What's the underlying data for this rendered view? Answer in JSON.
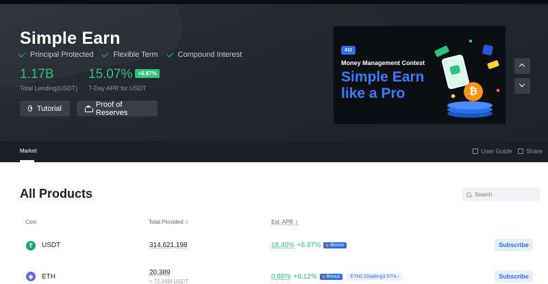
{
  "hero": {
    "title": "Simple Earn",
    "features": [
      "Principal Protected",
      "Flexible Term",
      "Compound Interest"
    ],
    "stats": [
      {
        "value": "1.17B",
        "label": "Total Lending(USDT)"
      },
      {
        "value": "15.07%",
        "badge": "+8.87%",
        "label": "7-Day APR for USDT"
      }
    ],
    "buttons": {
      "tutorial": "Tutorial",
      "reserves": "Proof of Reserves"
    },
    "banner": {
      "number": "#11",
      "subtitle": "Money Management Contest",
      "headline_1": "Simple Earn",
      "headline_2": "like a Pro"
    }
  },
  "tabs": {
    "market": "Market",
    "user_guide": "User Guide",
    "share": "Share"
  },
  "products": {
    "title": "All Products",
    "search_placeholder": "Search",
    "headers": {
      "coin": "Coin",
      "provided": "Total Provided",
      "apr": "Est. APR"
    },
    "sort_glyph": "⇕",
    "rows": [
      {
        "coin": "USDT",
        "icon": "T",
        "provided": "314,621,198",
        "provided_sub": "",
        "apr": "18.40%",
        "bonus_apr": "+8.87%",
        "bonus_label": "Bonus",
        "extra_tag": "",
        "action": "Subscribe"
      },
      {
        "coin": "ETH",
        "icon": "◆",
        "provided": "20,389",
        "provided_sub": "≈ 72.04M USDT",
        "apr": "0.88%",
        "bonus_apr": "+6.12%",
        "bonus_label": "Bonus",
        "extra_tag": "ETH2.0Staking3.57% ›",
        "action": "Subscribe"
      }
    ]
  },
  "colors": {
    "accent": "#2ec27e",
    "brand_blue": "#2b6fe8",
    "hero_bg": "#23272e"
  }
}
